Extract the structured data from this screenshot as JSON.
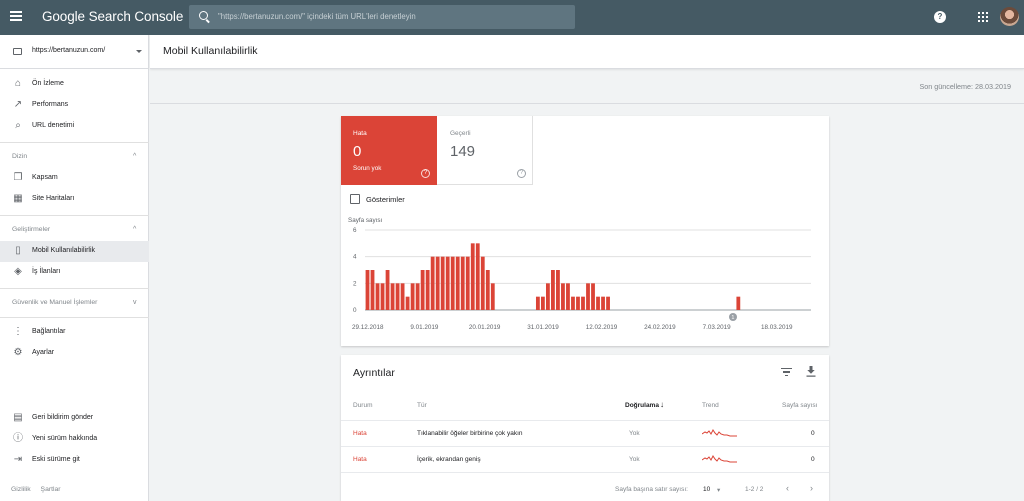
{
  "app": {
    "brand": "Google Search Console",
    "search_placeholder": "\"https://bertanuzun.com/\" içindeki tüm URL'leri denetleyin",
    "help_glyph": "?"
  },
  "sidebar": {
    "property": "https://bertanuzun.com/",
    "top_items": [
      {
        "label": "Ön İzleme",
        "icon": "home-icon"
      },
      {
        "label": "Performans",
        "icon": "trending-up-icon"
      },
      {
        "label": "URL denetimi",
        "icon": "search-icon"
      }
    ],
    "section_dizin": "Dizin",
    "dizin_items": [
      {
        "label": "Kapsam",
        "icon": "copy-icon"
      },
      {
        "label": "Site Haritaları",
        "icon": "sitemap-icon"
      }
    ],
    "section_gelistirmeler": "Geliştirmeler",
    "gelistirme_items": [
      {
        "label": "Mobil Kullanılabilirlik",
        "icon": "phone-icon"
      },
      {
        "label": "İş İlanları",
        "icon": "layers-icon"
      }
    ],
    "section_guvenlik": "Güvenlik ve Manuel İşlemler",
    "bottom_items": [
      {
        "label": "Bağlantılar",
        "icon": "links-icon"
      },
      {
        "label": "Ayarlar",
        "icon": "gear-icon"
      }
    ],
    "footer_items": [
      {
        "label": "Geri bildirim gönder",
        "icon": "feedback-icon"
      },
      {
        "label": "Yeni sürüm hakkında",
        "icon": "info-icon"
      },
      {
        "label": "Eski sürüme git",
        "icon": "exit-icon"
      }
    ],
    "links": [
      "Gizlilik",
      "Şartlar"
    ]
  },
  "page": {
    "title": "Mobil Kullanılabilirlik",
    "updated": "Son güncelleme: 28.03.2019"
  },
  "summary": {
    "error_label": "Hata",
    "error_value": "0",
    "error_sub": "Sorun yok",
    "valid_label": "Geçerli",
    "valid_value": "149",
    "toggle_label": "Gösterimler",
    "q": "?"
  },
  "chart_data": {
    "type": "bar",
    "ylabel": "Sayfa sayısı",
    "ylim": [
      0,
      6
    ],
    "yticks": [
      0,
      2,
      4,
      6
    ],
    "grid": true,
    "color": "#db4437",
    "categories_start": "29.12.2018",
    "values": [
      3,
      3,
      2,
      2,
      3,
      2,
      2,
      2,
      1,
      2,
      2,
      3,
      3,
      4,
      4,
      4,
      4,
      4,
      4,
      4,
      4,
      5,
      5,
      4,
      3,
      2,
      0,
      0,
      0,
      0,
      0,
      0,
      0,
      0,
      1,
      1,
      2,
      3,
      3,
      2,
      2,
      1,
      1,
      1,
      2,
      2,
      1,
      1,
      1,
      0,
      0,
      0,
      0,
      0,
      0,
      0,
      0,
      0,
      0,
      0,
      0,
      0,
      0,
      0,
      0,
      0,
      0,
      0,
      0,
      0,
      0,
      0,
      0,
      0,
      1,
      0,
      0,
      0,
      0,
      0,
      0,
      0,
      0,
      0,
      0,
      0,
      0,
      0,
      0
    ],
    "xtick_labels": [
      "29.12.2018",
      "9.01.2019",
      "20.01.2019",
      "31.01.2019",
      "12.02.2019",
      "24.02.2019",
      "7.03.2019",
      "18.03.2019"
    ],
    "annotation_label": "1"
  },
  "details": {
    "title": "Ayrıntılar",
    "columns": {
      "status": "Durum",
      "type": "Tür",
      "verify": "Doğrulama",
      "trend": "Trend",
      "pages": "Sayfa sayısı"
    },
    "rows": [
      {
        "status": "Hata",
        "type": "Tıklanabilir öğeler birbirine çok yakın",
        "verify": "Yok",
        "pages": "0"
      },
      {
        "status": "Hata",
        "type": "İçerik, ekrandan geniş",
        "verify": "Yok",
        "pages": "0"
      }
    ],
    "pager": {
      "rows_label": "Sayfa başına satır sayısı:",
      "rows_value": "10",
      "range": "1-2 / 2"
    }
  }
}
